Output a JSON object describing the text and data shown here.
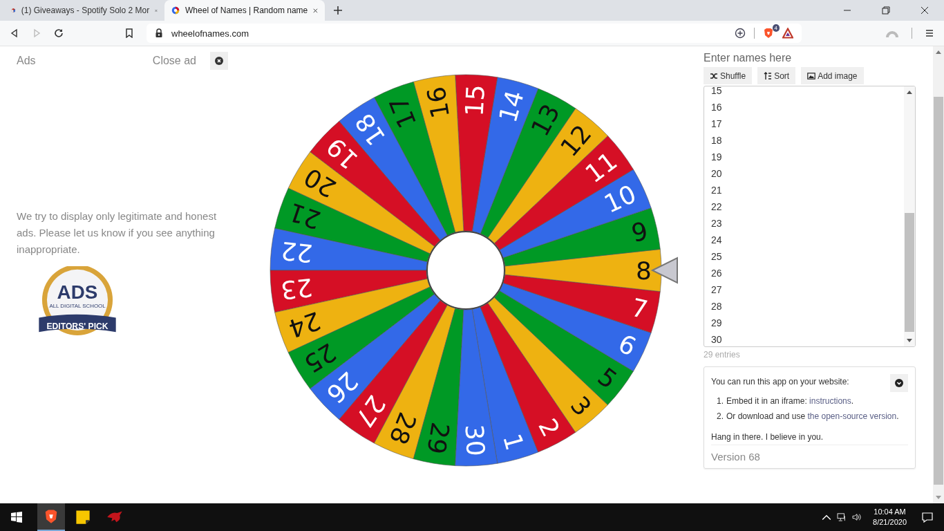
{
  "browser": {
    "tabs": [
      {
        "title": "(1) Giveaways - Spotify Solo 2 Mor",
        "selected": false
      },
      {
        "title": "Wheel of Names | Random name",
        "selected": true
      }
    ],
    "address": "wheelofnames.com",
    "shield_count": "4"
  },
  "ads": {
    "label": "Ads",
    "close": "Close ad",
    "notice": "We try to display only legitimate and honest ads. Please let us know if you see anything inappropriate.",
    "badge": {
      "title": "ADS",
      "subtitle": "ALL DIGITAL SCHOOL",
      "ribbon": "EDITORS' PICK"
    }
  },
  "wheel": {
    "segments": [
      {
        "label": "1",
        "color": "#3369e8"
      },
      {
        "label": "2",
        "color": "#d50f25"
      },
      {
        "label": "3",
        "color": "#eeb211"
      },
      {
        "label": "5",
        "color": "#009925"
      },
      {
        "label": "6",
        "color": "#3369e8"
      },
      {
        "label": "7",
        "color": "#d50f25"
      },
      {
        "label": "8",
        "color": "#eeb211"
      },
      {
        "label": "9",
        "color": "#009925"
      },
      {
        "label": "10",
        "color": "#3369e8"
      },
      {
        "label": "11",
        "color": "#d50f25"
      },
      {
        "label": "12",
        "color": "#eeb211"
      },
      {
        "label": "13",
        "color": "#009925"
      },
      {
        "label": "14",
        "color": "#3369e8"
      },
      {
        "label": "15",
        "color": "#d50f25"
      },
      {
        "label": "16",
        "color": "#eeb211"
      },
      {
        "label": "17",
        "color": "#009925"
      },
      {
        "label": "18",
        "color": "#3369e8"
      },
      {
        "label": "19",
        "color": "#d50f25"
      },
      {
        "label": "20",
        "color": "#eeb211"
      },
      {
        "label": "21",
        "color": "#009925"
      },
      {
        "label": "22",
        "color": "#3369e8"
      },
      {
        "label": "23",
        "color": "#d50f25"
      },
      {
        "label": "24",
        "color": "#eeb211"
      },
      {
        "label": "25",
        "color": "#009925"
      },
      {
        "label": "26",
        "color": "#3369e8"
      },
      {
        "label": "27",
        "color": "#d50f25"
      },
      {
        "label": "28",
        "color": "#eeb211"
      },
      {
        "label": "29",
        "color": "#009925"
      },
      {
        "label": "30",
        "color": "#3369e8"
      }
    ]
  },
  "entries": {
    "heading": "Enter names here",
    "buttons": [
      {
        "kind": "shuffle",
        "label": "Shuffle"
      },
      {
        "kind": "sort",
        "label": "Sort"
      },
      {
        "kind": "image",
        "label": "Add image"
      }
    ],
    "lines": [
      "15",
      "16",
      "17",
      "18",
      "19",
      "20",
      "21",
      "22",
      "23",
      "24",
      "25",
      "26",
      "27",
      "28",
      "29",
      "30"
    ],
    "count": "29 entries"
  },
  "info": {
    "intro": "You can run this app on your website:",
    "items": [
      {
        "number": "1.",
        "text": "Embed it in an iframe: ",
        "link": "instructions",
        "after": "."
      },
      {
        "number": "2.",
        "text": "Or download and use ",
        "link": "the open-source version",
        "after": "."
      }
    ],
    "closing": "Hang in there. I believe in you.",
    "version": "Version 68"
  },
  "taskbar": {
    "apps": [
      {
        "kind": "brave",
        "selected": true
      },
      {
        "kind": "notes",
        "selected": false
      },
      {
        "kind": "dragon",
        "selected": false
      }
    ],
    "time": "10:04 AM",
    "date": "8/21/2020"
  }
}
